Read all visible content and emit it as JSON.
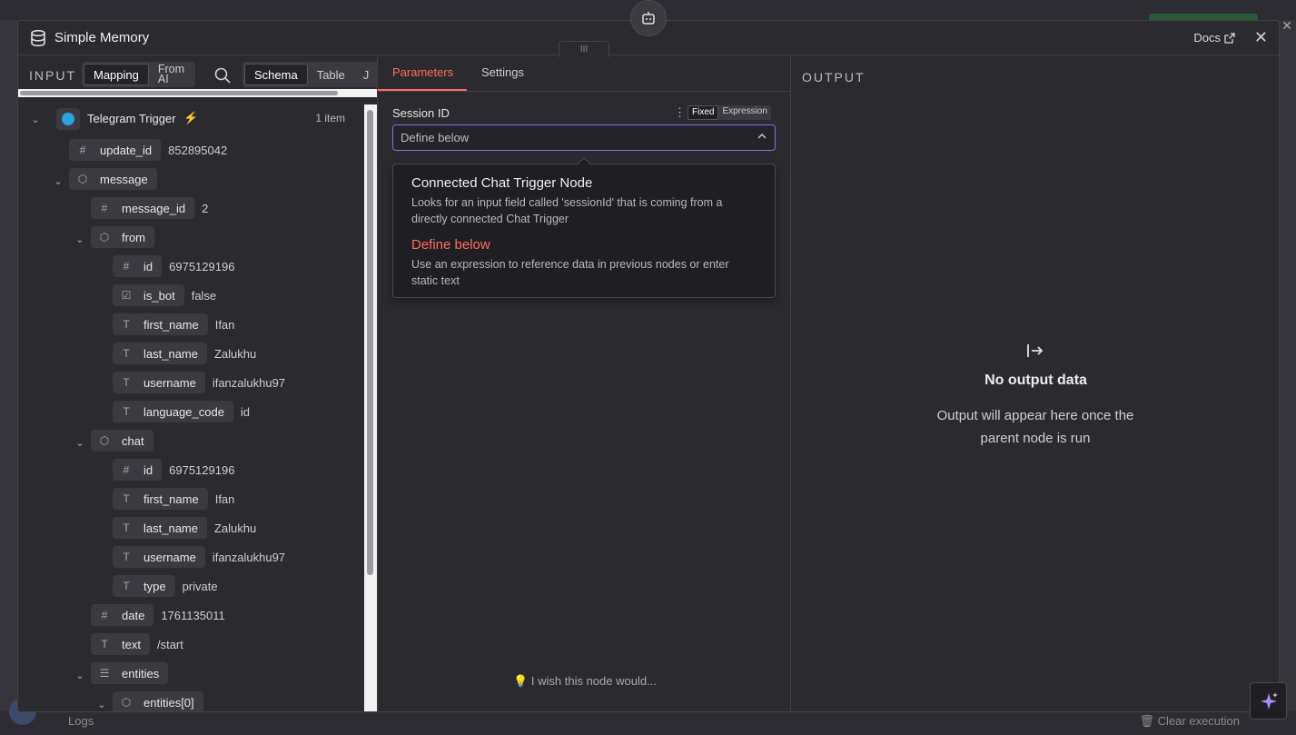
{
  "modal": {
    "title": "Simple Memory",
    "docs_label": "Docs",
    "drag_label": "III"
  },
  "input": {
    "label": "INPUT",
    "tabs_left": [
      "Mapping",
      "From\nAI"
    ],
    "tabs_right": [
      "Schema",
      "Table",
      "J"
    ],
    "trigger": {
      "label": "Telegram Trigger",
      "count": "1 item"
    },
    "fields": {
      "update_id": {
        "key": "update_id",
        "value": "852895042"
      },
      "message": {
        "key": "message"
      },
      "message_id": {
        "key": "message_id",
        "value": "2"
      },
      "from": {
        "key": "from"
      },
      "from_id": {
        "key": "id",
        "value": "6975129196"
      },
      "is_bot": {
        "key": "is_bot",
        "value": "false"
      },
      "first_name": {
        "key": "first_name",
        "value": "Ifan"
      },
      "last_name": {
        "key": "last_name",
        "value": "Zalukhu"
      },
      "username": {
        "key": "username",
        "value": "ifanzalukhu97"
      },
      "language_code": {
        "key": "language_code",
        "value": "id"
      },
      "chat": {
        "key": "chat"
      },
      "chat_id": {
        "key": "id",
        "value": "6975129196"
      },
      "chat_first_name": {
        "key": "first_name",
        "value": "Ifan"
      },
      "chat_last_name": {
        "key": "last_name",
        "value": "Zalukhu"
      },
      "chat_username": {
        "key": "username",
        "value": "ifanzalukhu97"
      },
      "chat_type": {
        "key": "type",
        "value": "private"
      },
      "date": {
        "key": "date",
        "value": "1761135011"
      },
      "text": {
        "key": "text",
        "value": "/start"
      },
      "entities": {
        "key": "entities"
      },
      "entities0": {
        "key": "entities[0]"
      }
    }
  },
  "params": {
    "tabs": [
      "Parameters",
      "Settings"
    ],
    "session_label": "Session ID",
    "toggle": [
      "Fixed",
      "Expression"
    ],
    "select_value": "Define below",
    "options": [
      {
        "title": "Connected Chat Trigger Node",
        "desc": "Looks for an input field called 'sessionId' that is coming from a directly connected Chat Trigger"
      },
      {
        "title": "Define below",
        "desc": "Use an expression to reference data in previous nodes or enter static text"
      }
    ],
    "wish": "I wish this node would..."
  },
  "output": {
    "label": "OUTPUT",
    "title": "No output data",
    "desc": "Output will appear here once the parent node is run"
  },
  "background": {
    "logs": "Logs",
    "clear": "Clear execution"
  },
  "colors": {
    "accent": "#ff6d5a",
    "focus": "#7a73e6",
    "telegram": "#2aa3e0"
  }
}
